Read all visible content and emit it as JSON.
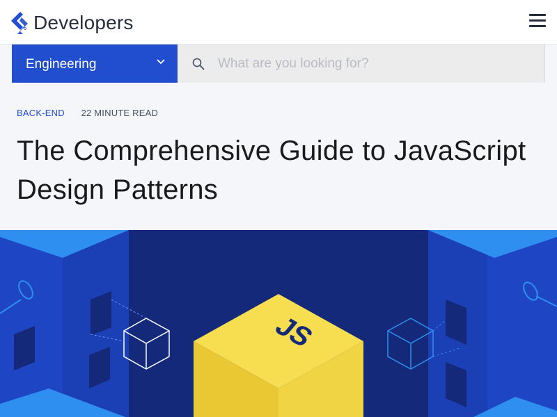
{
  "header": {
    "logo_text": "Developers",
    "logo_icon": "toptal-diamond-icon",
    "menu_icon": "hamburger-menu-icon"
  },
  "subnav": {
    "category_label": "Engineering",
    "search_placeholder": "What are you looking for?",
    "search_value": ""
  },
  "article": {
    "category": "BACK-END",
    "read_time": "22 MINUTE READ",
    "title": "The Comprehensive Guide to JavaScript Design Patterns"
  },
  "banner": {
    "logo_text": "JS"
  },
  "colors": {
    "brand_blue": "#204ecf",
    "banner_dark": "#14297a",
    "banner_mid": "#1e45c4",
    "banner_light": "#2f8ff0",
    "js_yellow": "#f6de50",
    "heading": "#1a1a1a",
    "header_bg": "#f4f6f9"
  }
}
